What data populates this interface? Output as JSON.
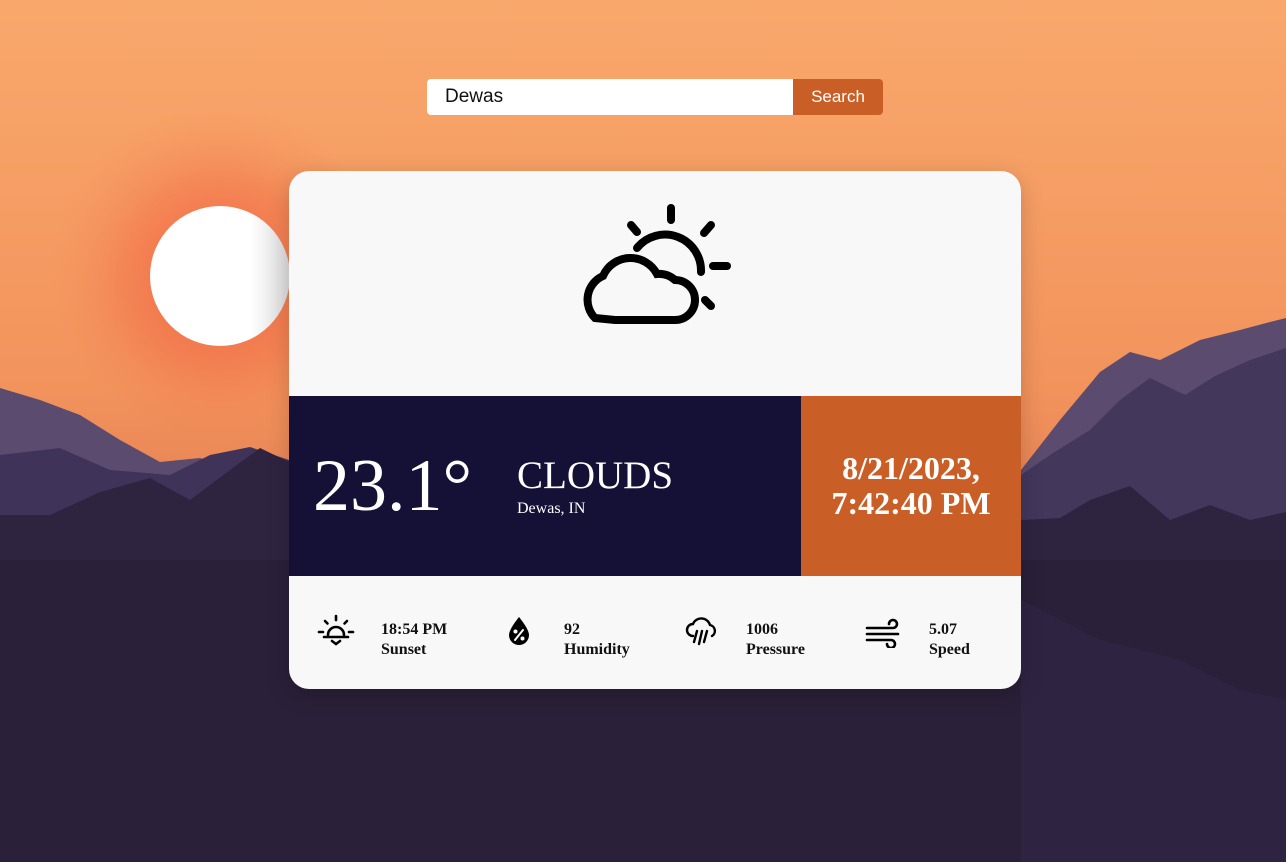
{
  "search": {
    "value": "Dewas",
    "button_label": "Search"
  },
  "weather": {
    "icon": "partly-cloudy-day-icon",
    "temperature": "23.1°",
    "condition": "CLOUDS",
    "location": "Dewas, IN",
    "date_line": "8/21/2023,",
    "time_line": "7:42:40 PM"
  },
  "stats": [
    {
      "icon": "sunset-icon",
      "value": "18:54 PM",
      "label": "Sunset"
    },
    {
      "icon": "humidity-icon",
      "value": "92",
      "label": "Humidity"
    },
    {
      "icon": "rain-cloud-icon",
      "value": "1006",
      "label": "Pressure"
    },
    {
      "icon": "wind-icon",
      "value": "5.07",
      "label": "Speed"
    }
  ],
  "colors": {
    "accent": "#c95f26",
    "panel_dark": "#141036",
    "card_bg": "#f8f8f8",
    "sky_top": "#f8a66a",
    "mountains": "#2a2039"
  }
}
